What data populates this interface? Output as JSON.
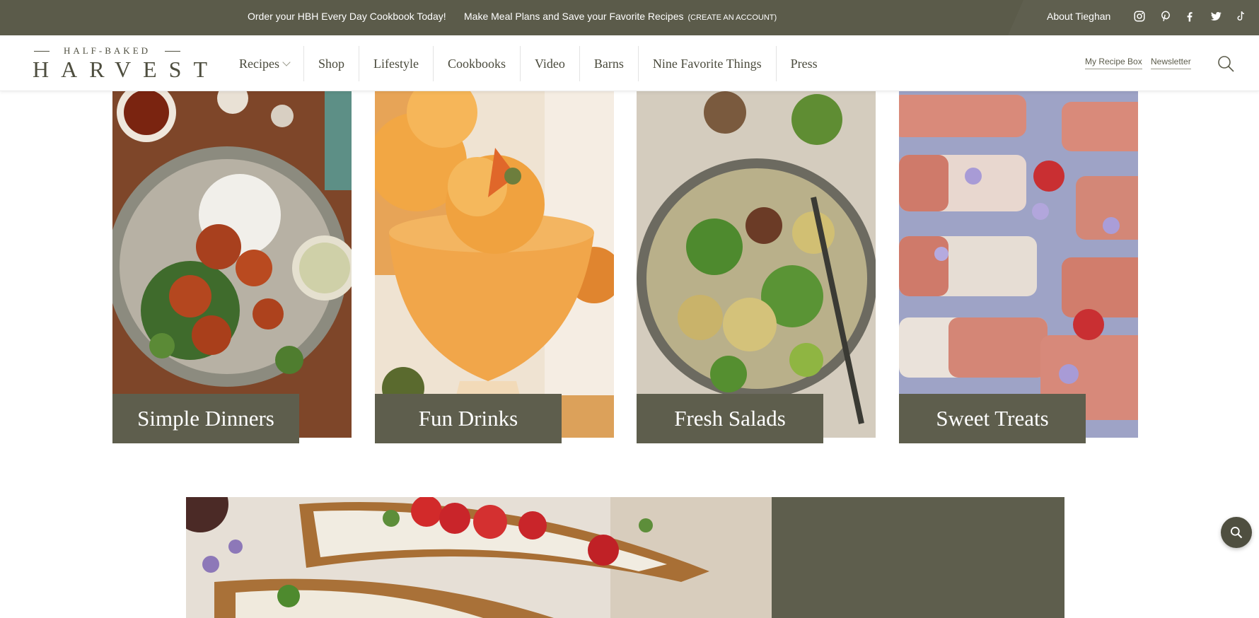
{
  "topbar": {
    "promo_cookbook": "Order your HBH Every Day Cookbook Today!",
    "promo_meal_plans": "Make Meal Plans and Save your Favorite Recipes",
    "promo_create_account": "(CREATE AN ACCOUNT)",
    "about": "About Tieghan",
    "social_icons": [
      "instagram-icon",
      "pinterest-icon",
      "facebook-icon",
      "twitter-icon",
      "tiktok-icon"
    ]
  },
  "logo": {
    "top_line": "HALF-BAKED",
    "main_line": "HARVEST"
  },
  "nav": {
    "items": [
      "Recipes",
      "Shop",
      "Lifestyle",
      "Cookbooks",
      "Video",
      "Barns",
      "Nine Favorite Things",
      "Press"
    ]
  },
  "utility": {
    "recipe_box": "My Recipe Box",
    "newsletter": "Newsletter"
  },
  "cards": [
    {
      "label": "Simple Dinners"
    },
    {
      "label": "Fun Drinks"
    },
    {
      "label": "Fresh Salads"
    },
    {
      "label": "Sweet Treats"
    }
  ],
  "colors": {
    "topbar": "#5b5b4a",
    "label_bg": "#5e5e4d",
    "text_dark": "#4a4a3c"
  }
}
